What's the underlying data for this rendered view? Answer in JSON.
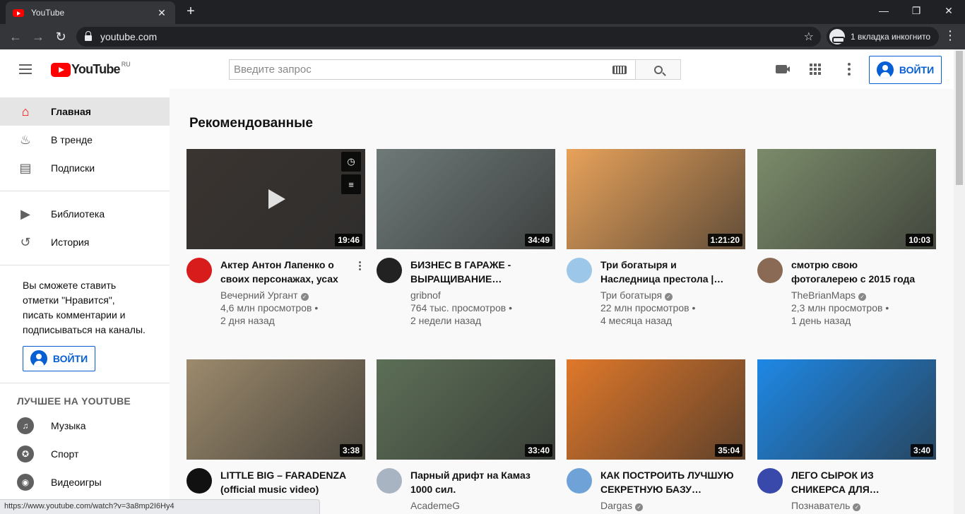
{
  "browser": {
    "tab_title": "YouTube",
    "tab_close": "✕",
    "new_tab": "+",
    "url": "youtube.com",
    "incognito_label": "1 вкладка инкогнито",
    "status_url": "https://www.youtube.com/watch?v=3a8mp2I6Hy4"
  },
  "header": {
    "logo_text": "YouTube",
    "logo_region": "RU",
    "search_placeholder": "Введите запрос",
    "signin_label": "ВОЙТИ"
  },
  "sidebar": {
    "items": [
      {
        "label": "Главная",
        "icon": "home-icon"
      },
      {
        "label": "В тренде",
        "icon": "fire-icon"
      },
      {
        "label": "Подписки",
        "icon": "subscriptions-icon"
      },
      {
        "label": "Библиотека",
        "icon": "library-icon"
      },
      {
        "label": "История",
        "icon": "history-icon"
      }
    ],
    "promo_text": "Вы сможете ставить отметки \"Нравится\", писать комментарии и подписываться на каналы.",
    "promo_button": "ВОЙТИ",
    "best_heading": "ЛУЧШЕЕ НА YOUTUBE",
    "best_items": [
      {
        "label": "Музыка",
        "icon": "music-icon"
      },
      {
        "label": "Спорт",
        "icon": "sport-icon"
      },
      {
        "label": "Видеоигры",
        "icon": "games-icon"
      }
    ]
  },
  "main": {
    "section_title": "Рекомендованные",
    "videos": [
      {
        "title": "Актер Антон Лапенко о своих персонажах, усах и…",
        "channel": "Вечерний Ургант",
        "verified": true,
        "views": "4,6 млн просмотров •",
        "age": "2 дня назад",
        "duration": "19:46",
        "thumb_color": "#3a3430",
        "avatar_color": "#d81b1b"
      },
      {
        "title": "БИЗНЕС В ГАРАЖЕ - ВЫРАЩИВАНИЕ…",
        "channel": "gribnof",
        "verified": false,
        "views": "764 тыс. просмотров •",
        "age": "2 недели назад",
        "duration": "34:49",
        "thumb_color": "#6e7a78",
        "avatar_color": "#222222"
      },
      {
        "title": "Три богатыря и Наследница престола |…",
        "channel": "Три богатыря",
        "verified": true,
        "views": "22 млн просмотров •",
        "age": "4 месяца назад",
        "duration": "1:21:20",
        "thumb_color": "#e8a25a",
        "avatar_color": "#9cc7e8"
      },
      {
        "title": "смотрю свою фотогалерею с 2015 года",
        "channel": "TheBrianMaps",
        "verified": true,
        "views": "2,3 млн просмотров •",
        "age": "1 день назад",
        "duration": "10:03",
        "thumb_color": "#7b8b6a",
        "avatar_color": "#8a6a55"
      },
      {
        "title": "LITTLE BIG – FARADENZA (official music video)",
        "channel": "",
        "verified": false,
        "views": "",
        "age": "",
        "duration": "3:38",
        "thumb_color": "#9c8a6c",
        "avatar_color": "#111111"
      },
      {
        "title": "Парный дрифт на Камаз 1000 сил.",
        "channel": "AcademeG",
        "verified": false,
        "views": "",
        "age": "",
        "duration": "33:40",
        "thumb_color": "#5d6f57",
        "avatar_color": "#a9b4c2"
      },
      {
        "title": "КАК ПОСТРОИТЬ ЛУЧШУЮ СЕКРЕТНУЮ БАЗУ…",
        "channel": "Dargas",
        "verified": true,
        "views": "",
        "age": "",
        "duration": "35:04",
        "thumb_color": "#e0782a",
        "avatar_color": "#6fa3d8"
      },
      {
        "title": "ЛЕГО СЫРОК ИЗ СНИКЕРСА ДЛЯ…",
        "channel": "Познаватель",
        "verified": true,
        "views": "",
        "age": "",
        "duration": "3:40",
        "thumb_color": "#1e88e5",
        "avatar_color": "#3949ab"
      }
    ]
  }
}
